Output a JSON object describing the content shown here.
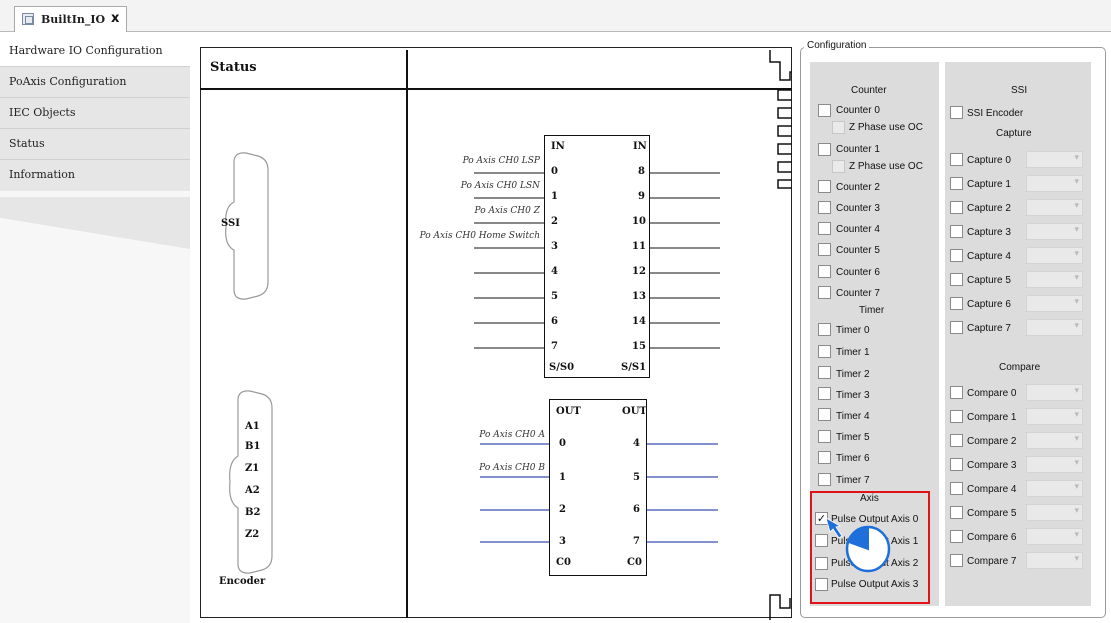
{
  "tab": {
    "label": "BuiltIn_IO",
    "close": "x"
  },
  "sidebar": {
    "items": [
      {
        "label": "Hardware IO Configuration"
      },
      {
        "label": "PoAxis Configuration"
      },
      {
        "label": "IEC Objects"
      },
      {
        "label": "Status"
      },
      {
        "label": "Information"
      }
    ]
  },
  "diagram": {
    "status_title": "Status",
    "ssi": "SSI",
    "encoder_pins": [
      "A1",
      "B1",
      "Z1",
      "A2",
      "B2",
      "Z2"
    ],
    "encoder_label": "Encoder",
    "in_left": {
      "header": "IN",
      "pins": [
        "0",
        "1",
        "2",
        "3",
        "4",
        "5",
        "6",
        "7"
      ],
      "footer": "S/S0"
    },
    "in_right": {
      "header": "IN",
      "pins": [
        "8",
        "9",
        "10",
        "11",
        "12",
        "13",
        "14",
        "15"
      ],
      "footer": "S/S1"
    },
    "in_signals": [
      "Po Axis CH0 LSP",
      "Po Axis CH0 LSN",
      "Po Axis CH0 Z",
      "Po Axis CH0 Home Switch"
    ],
    "out_left": {
      "header": "OUT",
      "pins": [
        "0",
        "1",
        "2",
        "3"
      ],
      "footer": "C0"
    },
    "out_right": {
      "header": "OUT",
      "pins": [
        "4",
        "5",
        "6",
        "7"
      ],
      "footer": "C0"
    },
    "out_signals": [
      "Po Axis CH0 A",
      "Po Axis CH0 B"
    ]
  },
  "config": {
    "title": "Configuration",
    "counter_header": "Counter",
    "counters": [
      "Counter 0",
      "Counter 1",
      "Counter 2",
      "Counter 3",
      "Counter 4",
      "Counter 5",
      "Counter 6",
      "Counter 7"
    ],
    "z_phase": "Z Phase use OC",
    "timer_header": "Timer",
    "timers": [
      "Timer 0",
      "Timer 1",
      "Timer 2",
      "Timer 3",
      "Timer 4",
      "Timer 5",
      "Timer 6",
      "Timer 7"
    ],
    "axis_header": "Axis",
    "axes": [
      {
        "label": "Pulse Output Axis 0",
        "checked": true
      },
      {
        "label": "Pulse Output Axis 1",
        "checked": false
      },
      {
        "label": "Pulse Output Axis 2",
        "checked": false
      },
      {
        "label": "Pulse Output Axis 3",
        "checked": false
      }
    ],
    "ssi_header": "SSI",
    "ssi_encoder": "SSI Encoder",
    "capture_header": "Capture",
    "captures": [
      "Capture 0",
      "Capture 1",
      "Capture 2",
      "Capture 3",
      "Capture 4",
      "Capture 5",
      "Capture 6",
      "Capture 7"
    ],
    "compare_header": "Compare",
    "compares": [
      "Compare 0",
      "Compare 1",
      "Compare 2",
      "Compare 3",
      "Compare 4",
      "Compare 5",
      "Compare 6",
      "Compare 7"
    ]
  },
  "colors": {
    "highlight": "#e0131b",
    "panel": "#dcdcdc",
    "cursor": "#1e6fd9"
  }
}
